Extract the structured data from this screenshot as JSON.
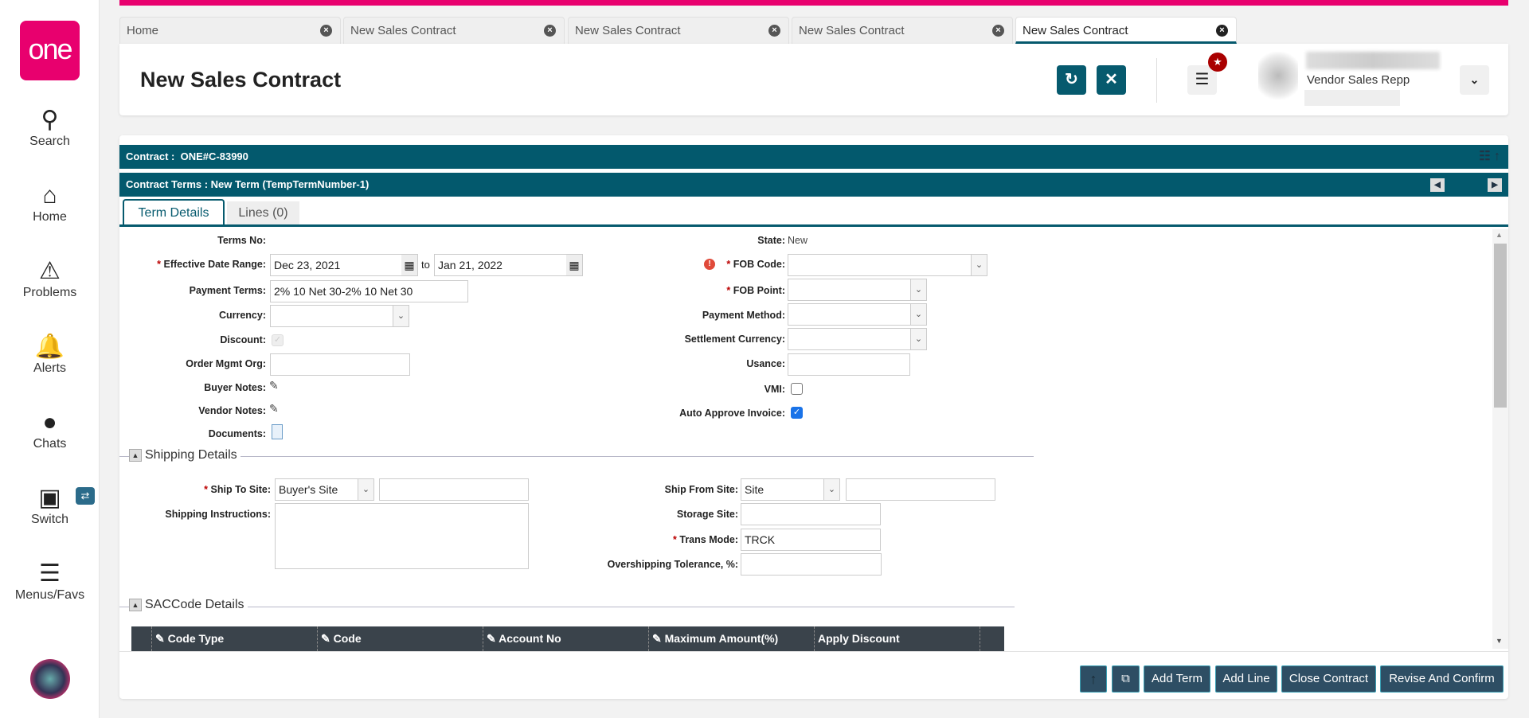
{
  "sidebar": {
    "logo": "one",
    "items": [
      {
        "label": "Search",
        "icon": "search-icon"
      },
      {
        "label": "Home",
        "icon": "home-icon"
      },
      {
        "label": "Problems",
        "icon": "warning-icon"
      },
      {
        "label": "Alerts",
        "icon": "bell-icon"
      },
      {
        "label": "Chats",
        "icon": "chat-icon"
      },
      {
        "label": "Switch",
        "icon": "switch-icon"
      },
      {
        "label": "Menus/Favs",
        "icon": "menu-icon"
      }
    ]
  },
  "tabs": [
    {
      "label": "Home"
    },
    {
      "label": "New Sales Contract"
    },
    {
      "label": "New Sales Contract"
    },
    {
      "label": "New Sales Contract"
    },
    {
      "label": "New Sales Contract",
      "active": true
    }
  ],
  "header": {
    "title": "New Sales Contract",
    "user_role": "Vendor Sales Repp"
  },
  "contract_bar": {
    "label": "Contract :",
    "value": "ONE#C-83990"
  },
  "terms_bar": {
    "text": "Contract Terms : New Term (TempTermNumber-1)"
  },
  "subtabs": [
    {
      "label": "Term Details"
    },
    {
      "label": "Lines (0)"
    }
  ],
  "form": {
    "terms_no": "Terms No:",
    "effective": "Effective Date Range:",
    "date_from": "Dec 23, 2021",
    "to": "to",
    "date_to": "Jan 21, 2022",
    "payment_terms": "Payment Terms:",
    "payment_terms_value": "2% 10 Net 30-2% 10 Net 30",
    "currency": "Currency:",
    "discount": "Discount:",
    "order_org": "Order Mgmt Org:",
    "buyer_notes": "Buyer Notes:",
    "vendor_notes": "Vendor Notes:",
    "documents": "Documents:",
    "state": "State:",
    "state_value": "New",
    "fob_code": "FOB Code:",
    "fob_point": "FOB Point:",
    "payment_method": "Payment Method:",
    "settlement_currency": "Settlement Currency:",
    "usance": "Usance:",
    "vmi": "VMI:",
    "auto_approve": "Auto Approve Invoice:",
    "star": "*"
  },
  "shipping": {
    "title": "Shipping Details",
    "ship_to": "Ship To Site:",
    "ship_to_value": "Buyer's Site",
    "instructions": "Shipping Instructions:",
    "ship_from": "Ship From Site:",
    "ship_from_value": "Site",
    "storage": "Storage Site:",
    "trans_mode": "Trans Mode:",
    "trans_mode_value": "TRCK",
    "overshipping": "Overshipping Tolerance, %:"
  },
  "saccode": {
    "title": "SACCode Details",
    "columns": [
      "Code Type",
      "Code",
      "Account No",
      "Maximum Amount(%)",
      "Apply Discount"
    ]
  },
  "footer": {
    "add_term": "Add Term",
    "add_line": "Add Line",
    "close_contract": "Close Contract",
    "revise": "Revise And Confirm"
  }
}
